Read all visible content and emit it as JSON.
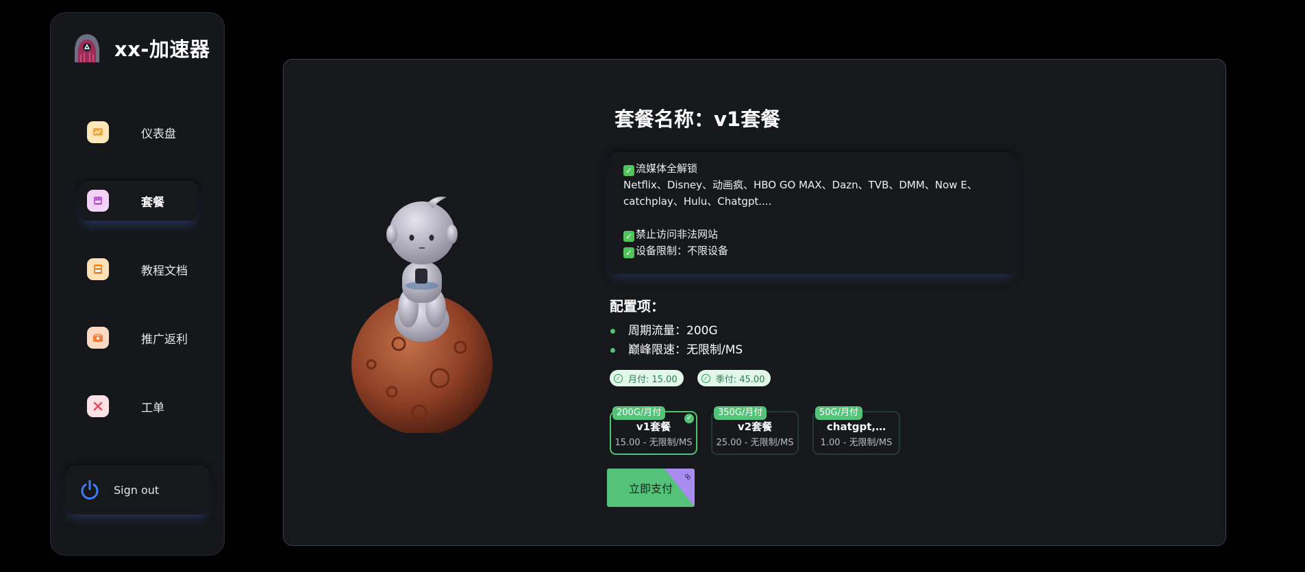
{
  "brand": {
    "title": "xx-加速器",
    "logo_icon": "hooded-avatar-logo"
  },
  "sidebar": {
    "items": [
      {
        "label": "仪表盘",
        "icon": "dashboard-icon",
        "active": false
      },
      {
        "label": "套餐",
        "icon": "package-icon",
        "active": true
      },
      {
        "label": "教程文档",
        "icon": "docs-icon",
        "active": false
      },
      {
        "label": "推广返利",
        "icon": "promo-icon",
        "active": false
      },
      {
        "label": "工单",
        "icon": "ticket-icon",
        "active": false
      }
    ],
    "signout_label": "Sign out"
  },
  "plan": {
    "title": "套餐名称：v1套餐",
    "description": {
      "line1": "流媒体全解锁",
      "line2": "Netflix、Disney、动画疯、HBO GO MAX、Dazn、TVB、DMM、Now E、",
      "line3": "catchplay、Hulu、Chatgpt....",
      "line4": "禁止访问非法网站",
      "line5": "设备限制：不限设备"
    },
    "config_title": "配置项：",
    "config_items": [
      "周期流量：200G",
      "巅峰限速：无限制/MS"
    ],
    "payment_periods": [
      "月付: 15.00",
      "季付: 45.00"
    ],
    "options": [
      {
        "badge": "200G/月付",
        "name": "v1套餐",
        "sub": "15.00 - 无限制/MS",
        "selected": true
      },
      {
        "badge": "350G/月付",
        "name": "v2套餐",
        "sub": "25.00 - 无限制/MS",
        "selected": false
      },
      {
        "badge": "50G/月付",
        "name": "chatgpt,…",
        "sub": "1.00 - 无限制/MS",
        "selected": false
      }
    ],
    "pay_button": "立即支付"
  },
  "colors": {
    "accent_green": "#55c27a",
    "corner_purple": "#a88cf0",
    "bg": "#000000",
    "card": "#17181b"
  }
}
